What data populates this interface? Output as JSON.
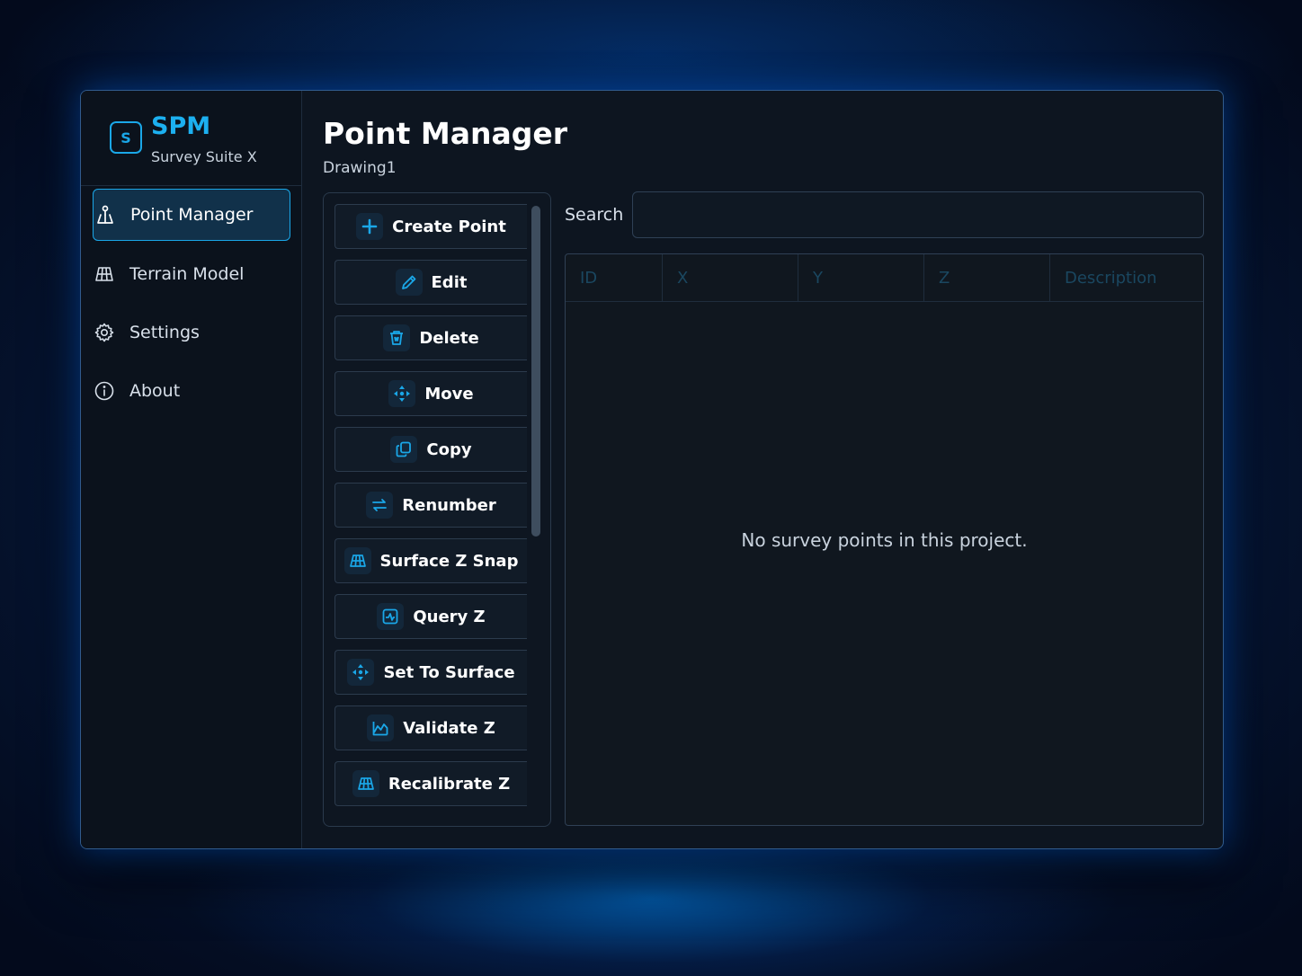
{
  "brand": {
    "logo_letter": "S",
    "name": "SPM",
    "subtitle": "Survey Suite X"
  },
  "sidebar": {
    "items": [
      {
        "label": "Point Manager",
        "icon": "survey-marker-icon",
        "active": true
      },
      {
        "label": "Terrain Model",
        "icon": "terrain-grid-icon",
        "active": false
      },
      {
        "label": "Settings",
        "icon": "gear-icon",
        "active": false
      },
      {
        "label": "About",
        "icon": "info-icon",
        "active": false
      }
    ]
  },
  "main": {
    "title": "Point Manager",
    "subtitle": "Drawing1"
  },
  "commands": [
    {
      "label": "Create Point",
      "icon": "plus-icon"
    },
    {
      "label": "Edit",
      "icon": "pencil-icon"
    },
    {
      "label": "Delete",
      "icon": "trash-icon"
    },
    {
      "label": "Move",
      "icon": "move-icon"
    },
    {
      "label": "Copy",
      "icon": "copy-icon"
    },
    {
      "label": "Renumber",
      "icon": "swap-icon"
    },
    {
      "label": "Surface Z Snap",
      "icon": "terrain-grid-icon"
    },
    {
      "label": "Query Z",
      "icon": "query-icon"
    },
    {
      "label": "Set To Surface",
      "icon": "move-icon"
    },
    {
      "label": "Validate Z",
      "icon": "chart-area-icon"
    },
    {
      "label": "Recalibrate Z",
      "icon": "terrain-grid-icon"
    }
  ],
  "search": {
    "label": "Search",
    "value": "",
    "placeholder": ""
  },
  "table": {
    "columns": [
      "ID",
      "X",
      "Y",
      "Z",
      "Description"
    ],
    "rows": [],
    "empty_message": "No survey points in this project."
  },
  "colors": {
    "accent": "#1aa7e8",
    "background": "#0d1520",
    "header_text": "#1a4760"
  }
}
